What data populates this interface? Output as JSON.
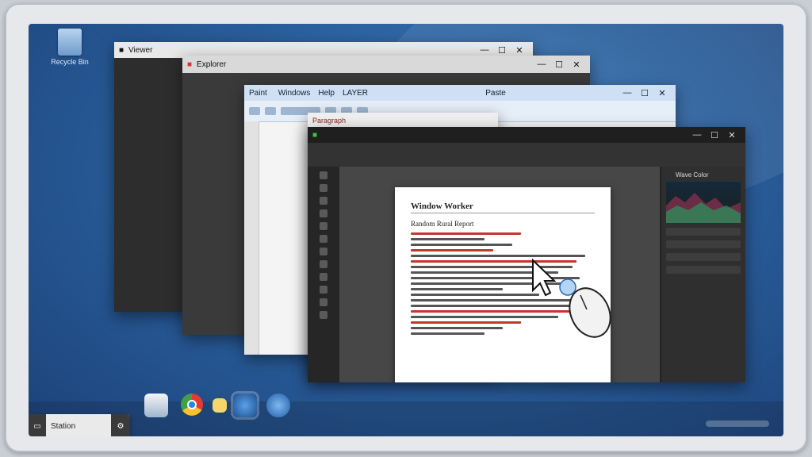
{
  "desktop": {
    "icon_label": "Recycle Bin"
  },
  "windows": {
    "back": {
      "title": "Viewer"
    },
    "second": {
      "title": "Explorer"
    },
    "third": {
      "title": "Paint",
      "menu": [
        "Windows",
        "Help",
        "LAYER"
      ],
      "center_label": "Paste"
    },
    "fourth": {
      "title": "Paragraph"
    },
    "front": {
      "panel_title": "Wave Color"
    }
  },
  "document": {
    "title": "Window Worker",
    "subtitle": "Random Rural Report",
    "lines": [
      {
        "w": 60,
        "red": true
      },
      {
        "w": 40,
        "red": false
      },
      {
        "w": 55,
        "red": false
      },
      {
        "w": 45,
        "red": true
      },
      {
        "w": 95,
        "red": false
      },
      {
        "w": 90,
        "red": true
      },
      {
        "w": 88,
        "red": false
      },
      {
        "w": 80,
        "red": false
      },
      {
        "w": 92,
        "red": false
      },
      {
        "w": 85,
        "red": false
      },
      {
        "w": 50,
        "red": false
      },
      {
        "w": 70,
        "red": false
      },
      {
        "w": 96,
        "red": false
      },
      {
        "w": 90,
        "red": false
      },
      {
        "w": 94,
        "red": true
      },
      {
        "w": 80,
        "red": false
      },
      {
        "w": 60,
        "red": true
      },
      {
        "w": 50,
        "red": false
      },
      {
        "w": 40,
        "red": false
      }
    ]
  },
  "taskbar": {
    "start_label": "Station",
    "apps": [
      {
        "icon": "file-icon"
      },
      {
        "icon": "chrome-icon"
      },
      {
        "icon": "folder-icon"
      },
      {
        "icon": "browser-icon"
      },
      {
        "icon": "network-icon"
      }
    ]
  },
  "colors": {
    "desktop": "#2a5f9c",
    "accent_red": "#c0392b"
  }
}
